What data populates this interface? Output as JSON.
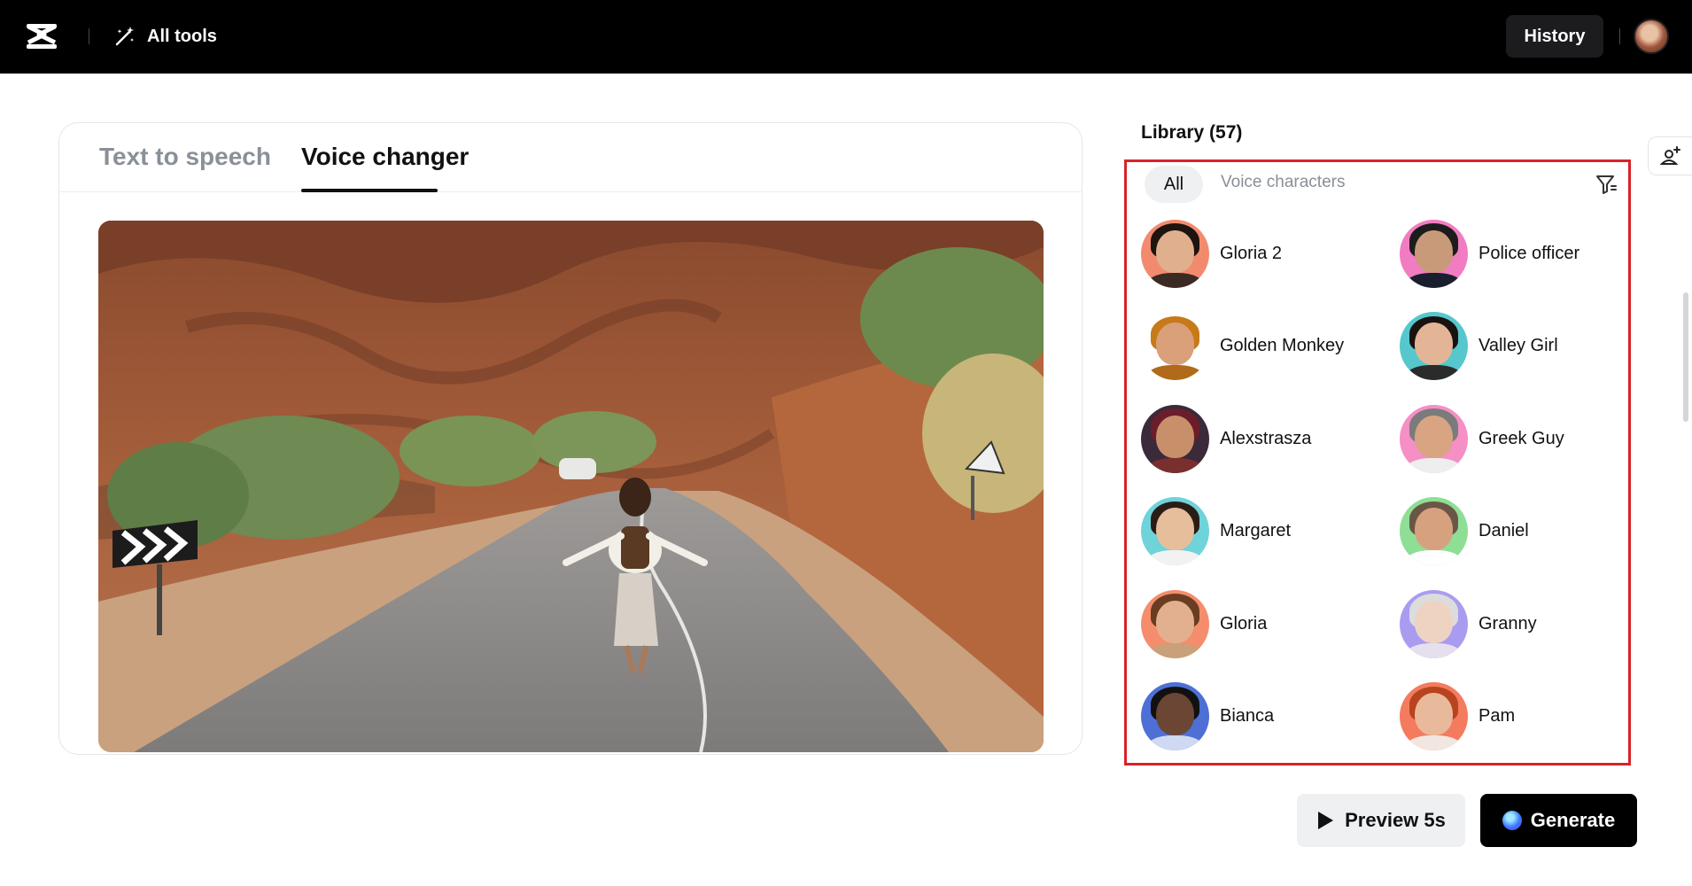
{
  "topbar": {
    "all_tools_label": "All tools",
    "history_label": "History"
  },
  "tabs": [
    {
      "label": "Text to speech",
      "active": false
    },
    {
      "label": "Voice changer",
      "active": true
    }
  ],
  "library": {
    "title": "Library (57)",
    "filters": {
      "all_label": "All",
      "voice_characters_label": "Voice characters"
    },
    "voices": [
      {
        "name": "Gloria 2",
        "icon": "avatar-woman-dark-hair",
        "bg": "#f28b6e"
      },
      {
        "name": "Police officer",
        "icon": "avatar-police-officer",
        "bg": "#f17cc1"
      },
      {
        "name": "Golden Monkey",
        "icon": "avatar-golden-monkey",
        "bg": "#ffffff"
      },
      {
        "name": "Valley Girl",
        "icon": "avatar-woman-long-hair",
        "bg": "#56c7cc"
      },
      {
        "name": "Alexstrasza",
        "icon": "avatar-fantasy-dragon",
        "bg": "#3a2a3a"
      },
      {
        "name": "Greek Guy",
        "icon": "avatar-man-grey-hair",
        "bg": "#f58fc6"
      },
      {
        "name": "Margaret",
        "icon": "avatar-young-man",
        "bg": "#6fd3da"
      },
      {
        "name": "Daniel",
        "icon": "avatar-man-white-shirt",
        "bg": "#8fde95"
      },
      {
        "name": "Gloria",
        "icon": "avatar-woman-smiling",
        "bg": "#f58d6d"
      },
      {
        "name": "Granny",
        "icon": "avatar-elderly-woman",
        "bg": "#a99cf0"
      },
      {
        "name": "Bianca",
        "icon": "avatar-woman-curly-hair",
        "bg": "#4d6fd6"
      },
      {
        "name": "Pam",
        "icon": "avatar-woman-red-hair",
        "bg": "#f47b5e"
      }
    ]
  },
  "actions": {
    "preview_label": "Preview 5s",
    "generate_label": "Generate"
  },
  "colors": {
    "topbar_bg": "#000000",
    "highlight_border": "#d8232a",
    "generate_bg": "#000000"
  }
}
